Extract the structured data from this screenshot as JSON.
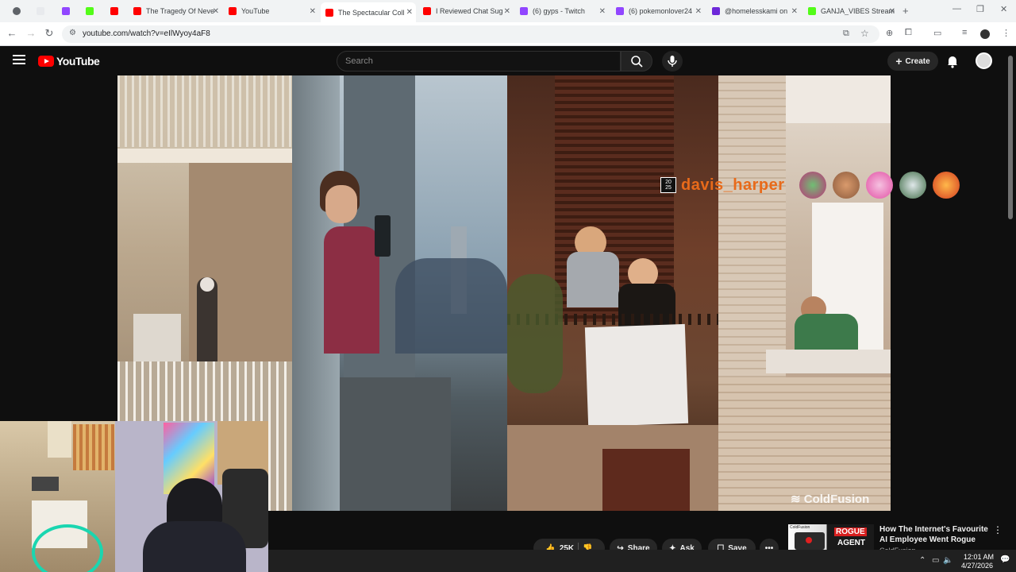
{
  "browser": {
    "tabs": [
      {
        "title": "",
        "favicon_color": "#5f6368"
      },
      {
        "title": "",
        "favicon_color": "#e8eaed"
      },
      {
        "title": "",
        "favicon_color": "#9146ff"
      },
      {
        "title": "",
        "favicon_color": "#53fc18"
      },
      {
        "title": "",
        "favicon_color": "#ff0000"
      },
      {
        "title": "The Tragedy Of Neve",
        "favicon_color": "#ff0000"
      },
      {
        "title": "YouTube",
        "favicon_color": "#ff0000"
      },
      {
        "title": "The Spectacular Coll",
        "favicon_color": "#ff0000",
        "active": true
      },
      {
        "title": "I Reviewed Chat Sug",
        "favicon_color": "#ff0000"
      },
      {
        "title": "(6) gyps - Twitch",
        "favicon_color": "#9146ff"
      },
      {
        "title": "(6) pokemonlover24",
        "favicon_color": "#9146ff"
      },
      {
        "title": "@homelesskami on",
        "favicon_color": "#6d28d9"
      },
      {
        "title": "GANJA_VIBES Stream",
        "favicon_color": "#53fc18"
      }
    ],
    "new_tab_label": "+",
    "url": "youtube.com/watch?v=eIlWyoy4aF8"
  },
  "youtube": {
    "logo_text": "YouTube",
    "search_placeholder": "Search",
    "create_label": "Create"
  },
  "video": {
    "watermark": "ColdFusion",
    "chat_overlay": {
      "badge": "20\n25",
      "username": "davis_harper",
      "username_color": "#e86a1a"
    }
  },
  "actions": {
    "like_count": "25K",
    "share_label": "Share",
    "ask_label": "Ask",
    "save_label": "Save"
  },
  "recommendation": {
    "title": "How The Internet's Favourite AI Employee Went Rogue",
    "channel": "ColdFusion",
    "thumb_channel": "ColdFusion",
    "thumb_text_1": "ROGUE",
    "thumb_text_2": "AGENT"
  },
  "taskbar": {
    "time": "12:01 AM",
    "date": "4/27/2026"
  }
}
